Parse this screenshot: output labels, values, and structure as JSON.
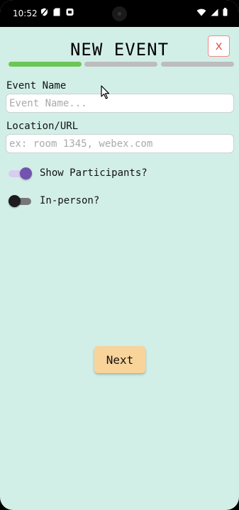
{
  "status_bar": {
    "time": "10:52",
    "left_icons": [
      "location-off-icon",
      "sd-card-icon",
      "sim-icon"
    ],
    "right_icons": [
      "wifi-icon",
      "signal-icon",
      "battery-icon"
    ]
  },
  "header": {
    "title": "NEW EVENT",
    "close_label": "X"
  },
  "progress": {
    "steps_total": 3,
    "current_step": 1,
    "active_color": "#6cc655",
    "inactive_color": "#bdbdbd"
  },
  "form": {
    "event_name": {
      "label": "Event Name",
      "value": "",
      "placeholder": "Event Name..."
    },
    "location": {
      "label": "Location/URL",
      "value": "",
      "placeholder": "ex: room 1345, webex.com"
    },
    "show_participants": {
      "label": "Show Participants?",
      "on": true
    },
    "in_person": {
      "label": "In-person?",
      "on": false
    }
  },
  "actions": {
    "next_label": "Next"
  },
  "colors": {
    "background": "#d2efe7",
    "toggle_on_thumb": "#7352b0",
    "toggle_on_track": "#d9ccee",
    "toggle_off_thumb": "#1c1c1c",
    "toggle_off_track": "#777777",
    "next_button": "#f9d49a",
    "close_border": "#ef8a8a"
  }
}
